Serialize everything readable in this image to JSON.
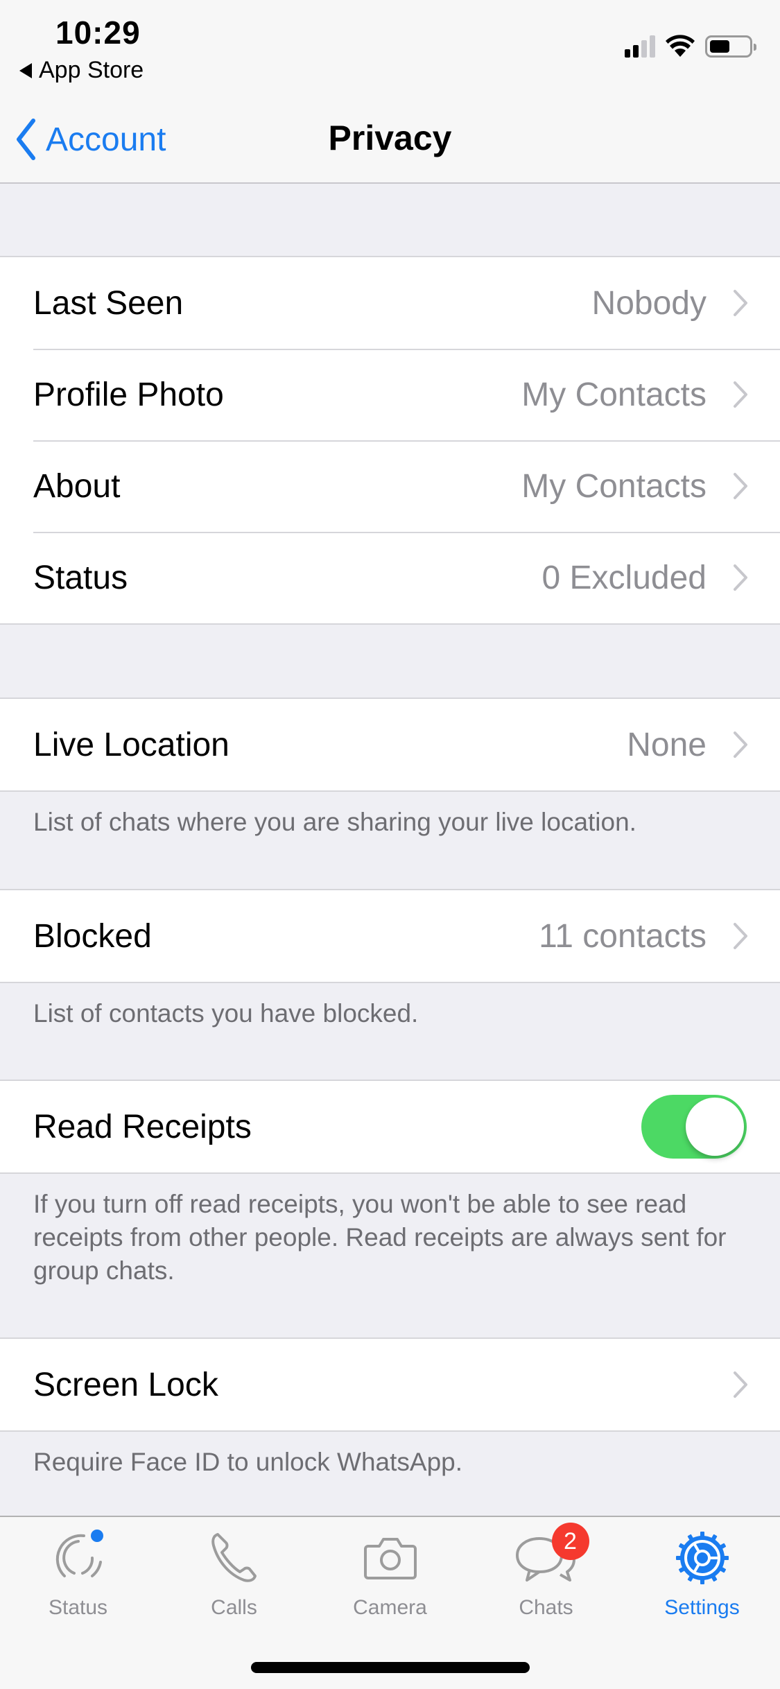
{
  "status_bar": {
    "time": "10:29",
    "back_app_label": "App Store",
    "signal_bars_active": 2,
    "signal_bars_total": 4,
    "battery_level": 0.4
  },
  "nav": {
    "back_label": "Account",
    "title": "Privacy"
  },
  "sections": {
    "visibility": [
      {
        "label": "Last Seen",
        "value": "Nobody"
      },
      {
        "label": "Profile Photo",
        "value": "My Contacts"
      },
      {
        "label": "About",
        "value": "My Contacts"
      },
      {
        "label": "Status",
        "value": "0 Excluded"
      }
    ],
    "live_location": {
      "label": "Live Location",
      "value": "None",
      "footer": "List of chats where you are sharing your live location."
    },
    "blocked": {
      "label": "Blocked",
      "value": "11 contacts",
      "footer": "List of contacts you have blocked."
    },
    "read_receipts": {
      "label": "Read Receipts",
      "enabled": true,
      "footer": "If you turn off read receipts, you won't be able to see read receipts from other people. Read receipts are always sent for group chats."
    },
    "screen_lock": {
      "label": "Screen Lock",
      "value": "",
      "footer": "Require Face ID to unlock WhatsApp."
    }
  },
  "tabbar": {
    "tabs": [
      {
        "label": "Status",
        "icon": "status-icon",
        "has_dot": true
      },
      {
        "label": "Calls",
        "icon": "phone-icon"
      },
      {
        "label": "Camera",
        "icon": "camera-icon"
      },
      {
        "label": "Chats",
        "icon": "chats-icon",
        "badge": "2"
      },
      {
        "label": "Settings",
        "icon": "gear-icon",
        "active": true
      }
    ]
  },
  "colors": {
    "accent": "#1a7cf0",
    "toggle_on": "#4cd964",
    "badge": "#f5392e",
    "secondary_text": "#8e8e93",
    "background": "#efeff4"
  }
}
